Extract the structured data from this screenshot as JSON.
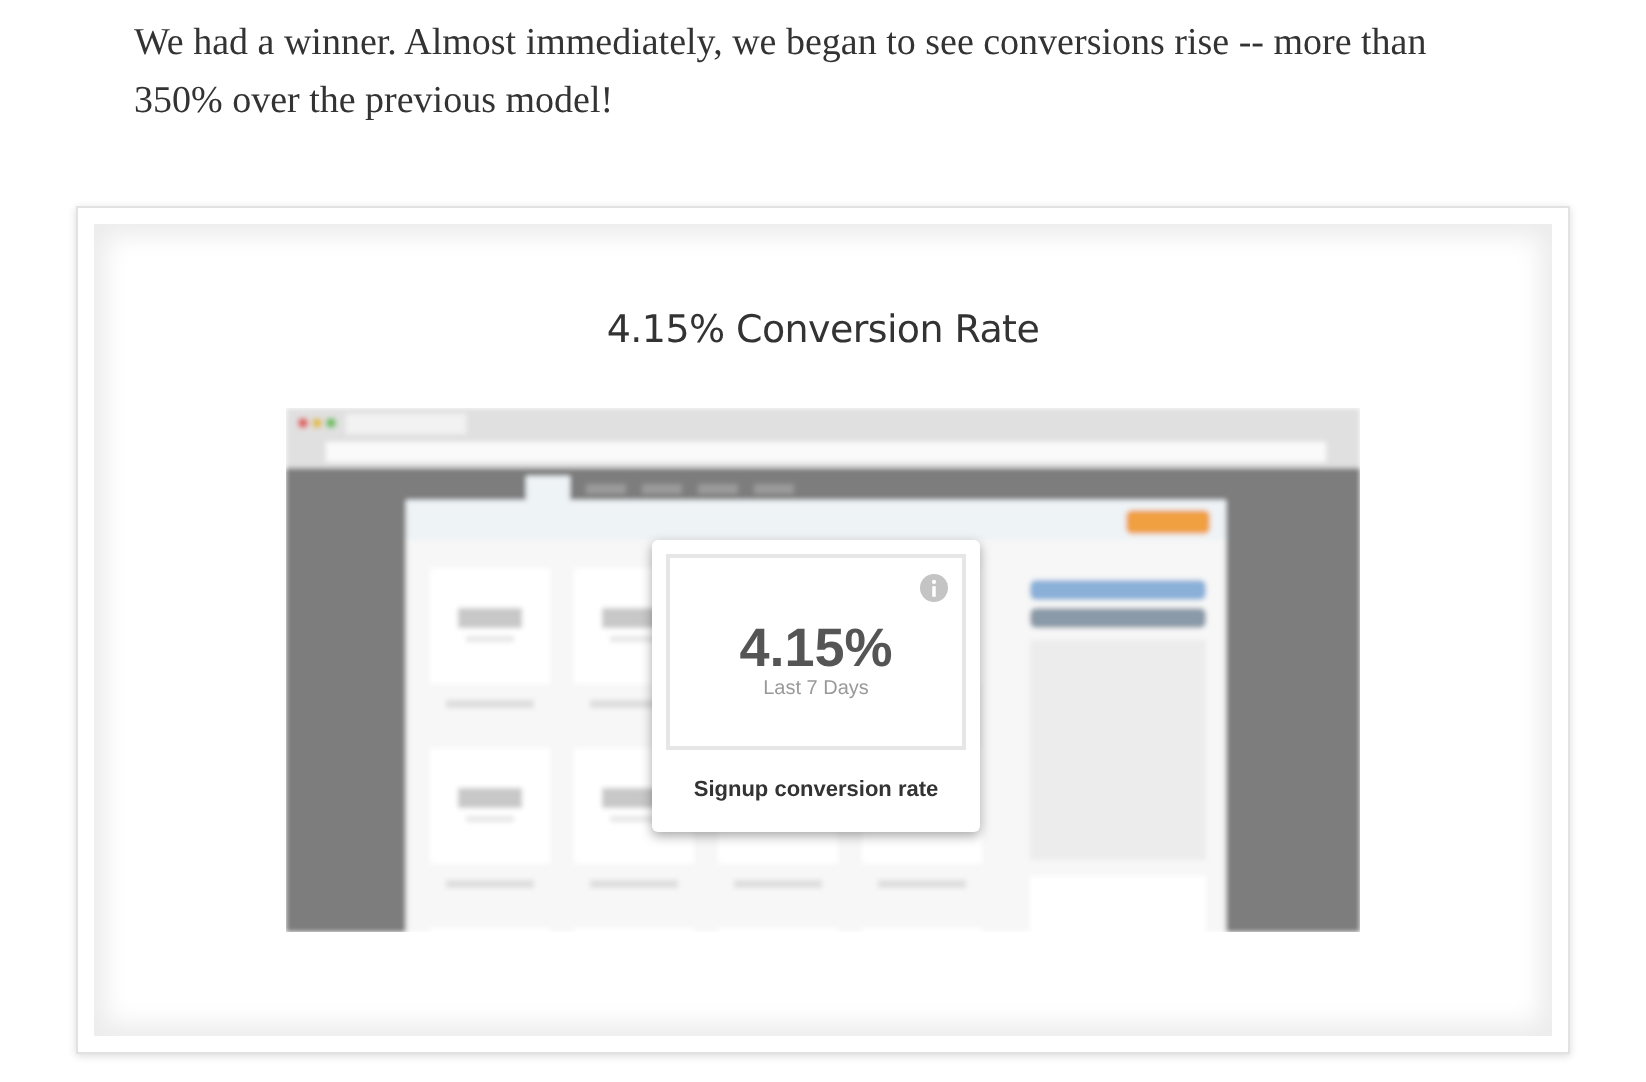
{
  "article": {
    "paragraph": "We had a winner. Almost immediately, we began to see conversions rise -- more than 350% over the previous model!"
  },
  "figure": {
    "title": "4.15% Conversion Rate",
    "screenshot": {
      "popup": {
        "value": "4.15%",
        "period": "Last 7 Days",
        "label": "Signup conversion rate"
      }
    }
  }
}
